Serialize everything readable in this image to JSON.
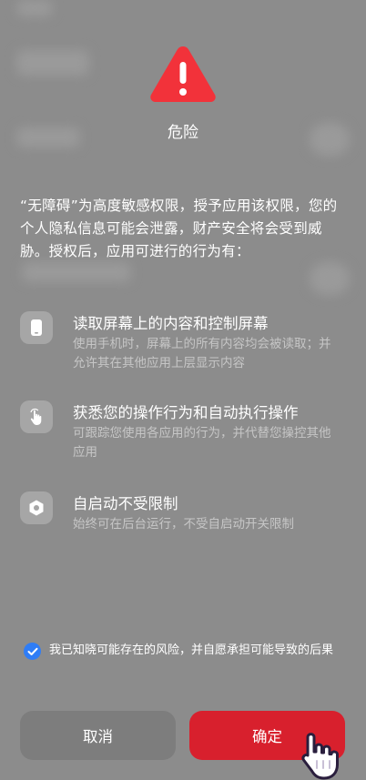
{
  "dialog": {
    "title": "危险",
    "description": "“无障碍”为高度敏感权限，授予应用该权限，您的个人隐私信息可能会泄露，财产安全将会受到威胁。授权后，应用可进行的行为有：",
    "permissions": [
      {
        "title": "读取屏幕上的内容和控制屏幕",
        "desc": "使用手机时，屏幕上的所有内容均会被读取；并允许其在其他应用上层显示内容",
        "icon": "phone-icon"
      },
      {
        "title": "获悉您的操作行为和自动执行操作",
        "desc": "可跟踪您使用各应用的行为，并代替您操控其他应用",
        "icon": "touch-hand-icon"
      },
      {
        "title": "自启动不受限制",
        "desc": "始终可在后台运行，不受自启动开关限制",
        "icon": "hexagon-icon"
      }
    ],
    "acknowledge": {
      "checked": true,
      "text": "我已知晓可能存在的风险，并自愿承担可能导致的后果"
    },
    "cancel_label": "取消",
    "confirm_label": "确定"
  },
  "colors": {
    "warning": "#f2323a",
    "confirm": "#d8202d",
    "checkbox": "#2f7df6"
  }
}
